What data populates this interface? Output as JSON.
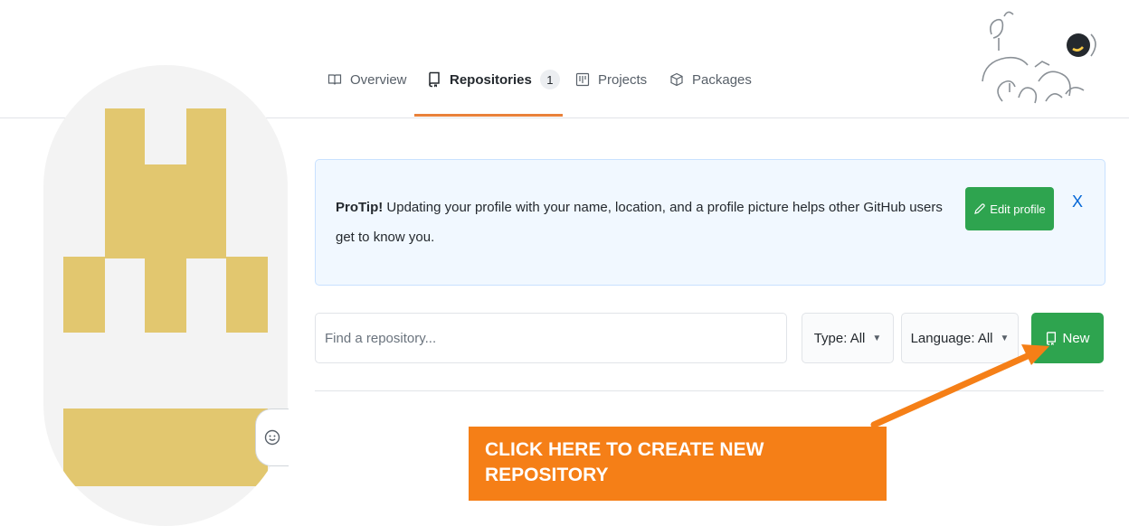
{
  "nav": {
    "tabs": [
      {
        "label": "Overview",
        "icon": "book-icon"
      },
      {
        "label": "Repositories",
        "icon": "repo-icon",
        "count": "1",
        "active": true
      },
      {
        "label": "Projects",
        "icon": "project-icon"
      },
      {
        "label": "Packages",
        "icon": "package-icon"
      }
    ]
  },
  "protip": {
    "title": "ProTip!",
    "text": " Updating your profile with your name, location, and a profile picture helps other GitHub users get to know you.",
    "edit_button": "Edit profile",
    "close_label": "X"
  },
  "filters": {
    "search_placeholder": "Find a repository...",
    "type_label": "Type:",
    "type_value": "All",
    "language_label": "Language:",
    "language_value": "All",
    "new_button": "New"
  },
  "callout": {
    "text": "CLICK HERE TO CREATE NEW REPOSITORY"
  },
  "colors": {
    "accent_green": "#2ea44f",
    "callout_orange": "#f57f17",
    "avatar_gold": "#e2c76f",
    "link_blue": "#0366d6"
  }
}
